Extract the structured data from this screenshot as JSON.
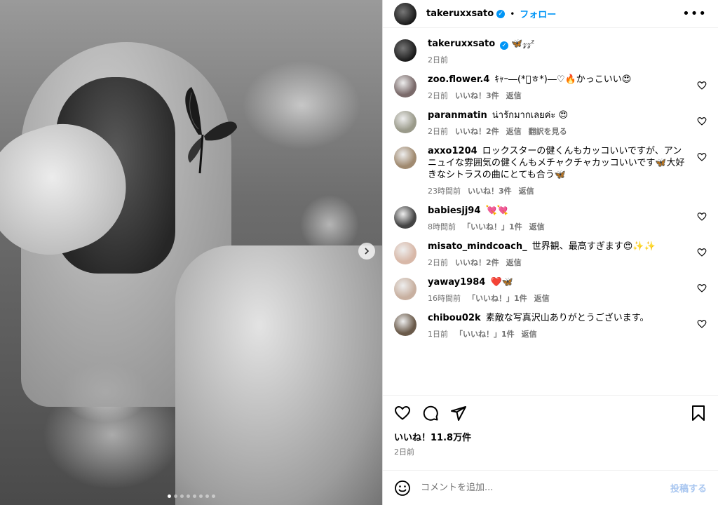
{
  "post": {
    "username": "takeruxxsato",
    "follow_label": "フォロー",
    "caption": "🦋𝓏𝓏ᶻ",
    "caption_time": "2日前",
    "likes": "いいね！11.8万件",
    "date": "2日前"
  },
  "comments": [
    {
      "user": "zoo.flower.4",
      "text": "ｷｬｰ―(*ㅎ̤̮ㅎ*)―♡🔥かっこいい😍",
      "time": "2日前",
      "likes": "いいね！3件",
      "reply": "返信",
      "translate": "",
      "avatar_color": "#7a6a6a"
    },
    {
      "user": "paranmatin",
      "text": "น่ารักมากเลยค่ะ 😍",
      "time": "2日前",
      "likes": "いいね！2件",
      "reply": "返信",
      "translate": "翻訳を見る",
      "avatar_color": "#9a9a8a"
    },
    {
      "user": "axxo1204",
      "text": "ロックスターの健くんもカッコいいですが、アンニュイな雰囲気の健くんもメチャクチャカッコいいです🦋大好きなシトラスの曲にとても合う🦋",
      "time": "23時間前",
      "likes": "いいね！3件",
      "reply": "返信",
      "translate": "",
      "avatar_color": "#a08a70"
    },
    {
      "user": "babiesjj94",
      "text": "💘💘",
      "time": "8時間前",
      "likes": "「いいね！」1件",
      "reply": "返信",
      "translate": "",
      "avatar_color": "#444444"
    },
    {
      "user": "misato_mindcoach_",
      "text": "世界観、最高すぎます😍✨✨",
      "time": "2日前",
      "likes": "いいね！2件",
      "reply": "返信",
      "translate": "",
      "avatar_color": "#d8b8a8"
    },
    {
      "user": "yaway1984",
      "text": "❤️🦋",
      "time": "16時間前",
      "likes": "「いいね！」1件",
      "reply": "返信",
      "translate": "",
      "avatar_color": "#c8b0a0"
    },
    {
      "user": "chibou02k",
      "text": "素敵な写真沢山ありがとうございます。",
      "time": "1日前",
      "likes": "「いいね！」1件",
      "reply": "返信",
      "translate": "",
      "avatar_color": "#6a5a4a"
    }
  ],
  "composer": {
    "placeholder": "コメントを追加...",
    "post_label": "投稿する"
  },
  "colors": {
    "accent": "#0095f6",
    "muted": "#737373"
  }
}
